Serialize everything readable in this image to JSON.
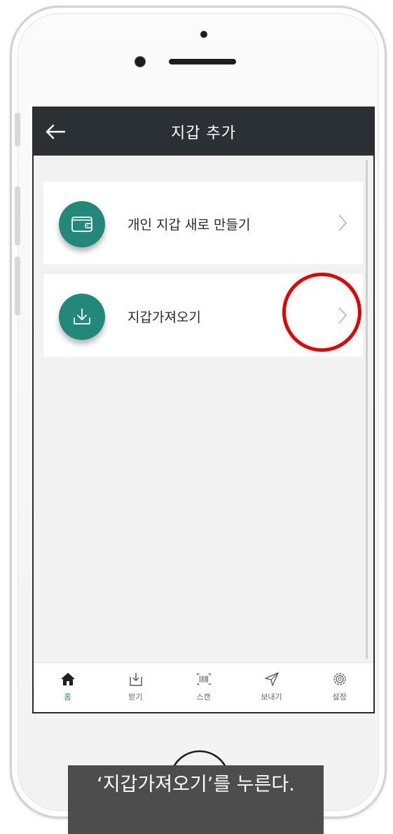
{
  "appbar": {
    "title": "지갑 추가"
  },
  "cards": [
    {
      "label": "개인 지갑 새로 만들기",
      "icon": "wallet-icon"
    },
    {
      "label": "지갑가져오기",
      "icon": "download-icon"
    }
  ],
  "nav": [
    {
      "label": "홈",
      "icon": "home-icon",
      "active": true
    },
    {
      "label": "받기",
      "icon": "receive-icon",
      "active": false
    },
    {
      "label": "스캔",
      "icon": "barcode-scan-icon",
      "active": false
    },
    {
      "label": "보내기",
      "icon": "send-icon",
      "active": false
    },
    {
      "label": "설정",
      "icon": "gear-icon",
      "active": false
    }
  ],
  "caption": "‘지갑가져오기’를 누른다.",
  "colors": {
    "accent": "#22887a",
    "appbar": "#2b3035",
    "highlight": "#e60000"
  }
}
